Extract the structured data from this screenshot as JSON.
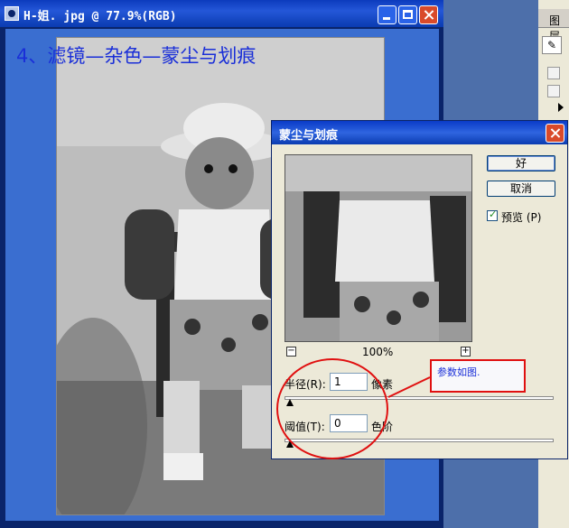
{
  "document_window": {
    "title": "H-姐. jpg @ 77.9%(RGB)",
    "instruction": "4、滤镜—杂色—蒙尘与划痕"
  },
  "palette": {
    "tab_label": "图层"
  },
  "dialog": {
    "title": "蒙尘与划痕",
    "ok_label": "好",
    "cancel_label": "取消",
    "preview_label": "预览",
    "preview_mnemonic": "(P)",
    "preview_checked": true,
    "zoom_value": "100%",
    "zoom_out_symbol": "−",
    "zoom_in_symbol": "+",
    "radius": {
      "label": "半径(R):",
      "value": "1",
      "unit": "像素",
      "slider_fraction": 0.0
    },
    "threshold": {
      "label": "阈值(T):",
      "value": "0",
      "unit": "色阶",
      "slider_fraction": 0.0
    }
  },
  "annotation": {
    "note_text": "参数如图.",
    "highlight_color": "#e01010",
    "text_color": "#1a2fd8"
  }
}
